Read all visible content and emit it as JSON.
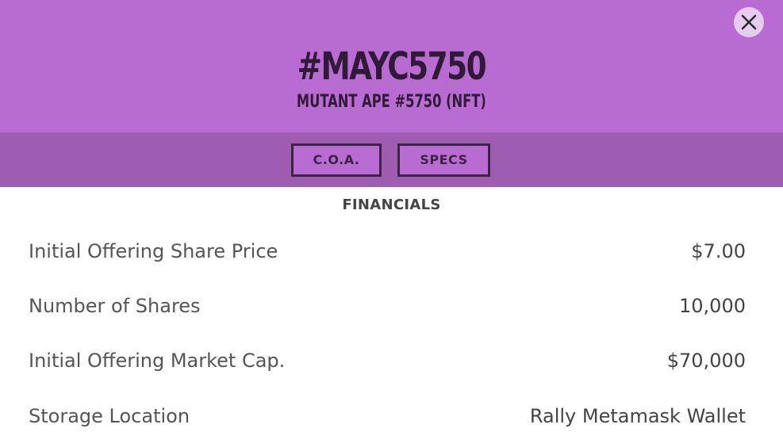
{
  "header": {
    "title": "#MAYC5750",
    "subtitle": "MUTANT APE #5750 (NFT)",
    "close_icon": "close-icon"
  },
  "tabs": [
    {
      "label": "C.O.A."
    },
    {
      "label": "SPECS"
    }
  ],
  "financials": {
    "heading": "FINANCIALS",
    "rows": [
      {
        "label": "Initial Offering Share Price",
        "value": "$7.00"
      },
      {
        "label": "Number of Shares",
        "value": "10,000"
      },
      {
        "label": "Initial Offering Market Cap.",
        "value": "$70,000"
      },
      {
        "label": "Storage Location",
        "value": "Rally Metamask Wallet"
      }
    ]
  },
  "colors": {
    "header_bg": "#b86bd0",
    "tabs_bar_bg": "#9f5db2",
    "text_dark": "#2f1b36"
  }
}
